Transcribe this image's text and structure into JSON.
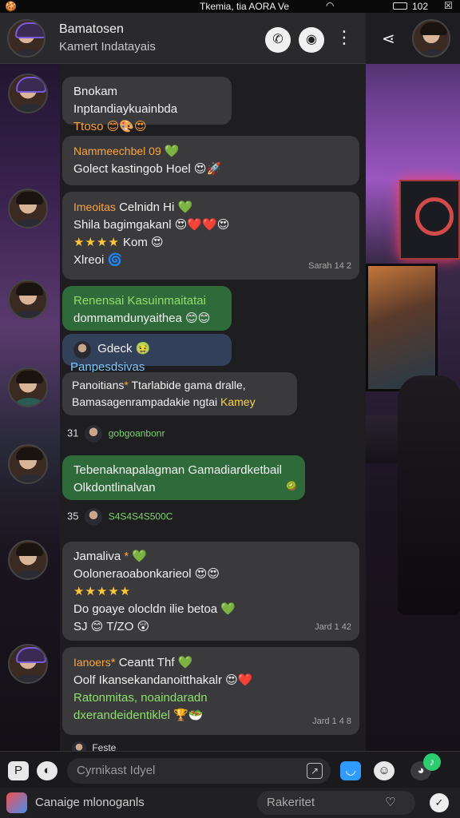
{
  "status_bar": {
    "left": "🍪",
    "center": "Tkemia, tia AORA Ve",
    "wifi_icon": "wifi-icon",
    "time": "102",
    "right": "☒"
  },
  "header": {
    "title": "Bamatosen",
    "subtitle": "Kamert Indatayais",
    "actions": [
      "phone-icon",
      "video-icon",
      "more-icon"
    ],
    "share_icon": "share-icon"
  },
  "messages": [
    {
      "text1": "Bnokam Inptandiaykuainbda",
      "text2": "Ttoso 😊🎨😍"
    },
    {
      "name": "Nammeechbel 09",
      "name_emoji": "💚",
      "text1": "Golect kastingob Hoel 😍🚀"
    },
    {
      "name": "Imeoitas",
      "name_tail": "Celnidn Hi",
      "name_emoji": "💚",
      "text1": "Shila bagimgakanl 😍❤️❤️😍",
      "stars": "★★★★",
      "stars_text": "Kom 😍",
      "text2": "Xlreoi 🌀",
      "stamp": "Sarah 14 2"
    },
    {
      "text1": "Renensai Kasuinmaitatai",
      "text2": "dommamdunyaithea 😊😊"
    },
    {
      "name": "Gdeck",
      "emoji": "🤢",
      "tail": "Panpesdsivas"
    },
    {
      "text1": "Panoitians",
      "text1_tail": "Ttarlabide gama dralle,",
      "text2": "Bamasagenrampadakie ngtai",
      "text2_tail": "Kamey"
    },
    {
      "left": "31",
      "alt": "gobgoanbonr"
    },
    {
      "text1": "Tebenaknapalagman Gamadiardketbail",
      "text2": "Olkdontlinalvan",
      "tail": "🥝"
    },
    {
      "left": "35",
      "alt": "S4S4S4S500C"
    },
    {
      "name": "Jamaliva",
      "name_emoji": "💚",
      "text1": "Ooloneraoabonkarieol 😍😍",
      "stars": "★★★★★",
      "text2": "Do goaye olocldn ilie betoa 💚",
      "text3": "SJ 😊 T/ZO 😲",
      "stamp": "Jard 1 42"
    },
    {
      "name": "Ianoers",
      "name_tail": "Ceantt Thf",
      "name_emoji": "💚",
      "text1": "Oolf Ikansekandanoitthakalr 😍❤️",
      "text2": "Ratonmitas, noaindaradn",
      "text3": "dxerandeidentiklel 🏆🥗",
      "stamp": "Jard 1 4 8"
    },
    {
      "peek": "Feste"
    }
  ],
  "input_bar": {
    "placeholder": "Cyrnikast Idyel",
    "field_icon": "attach-icon",
    "left_icons": [
      "app-p-icon",
      "app-chat-icon"
    ],
    "right_icons": [
      "camera-icon",
      "emoji-icon",
      "sticker-icon"
    ],
    "badge": "♪"
  },
  "bottom_bar": {
    "app_label": "Canaige mlonoganls",
    "field_text": "Rakeritet",
    "heart_icon": "heart-icon",
    "ok_icon": "check-icon"
  }
}
